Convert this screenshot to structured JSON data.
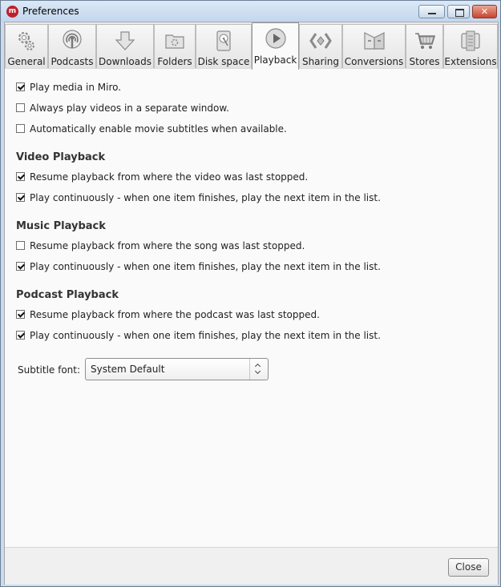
{
  "window": {
    "title": "Preferences",
    "app_icon": "m",
    "close_glyph": "✕"
  },
  "tabs": [
    {
      "label": "General",
      "icon": "gears-icon"
    },
    {
      "label": "Podcasts",
      "icon": "podcast-icon"
    },
    {
      "label": "Downloads",
      "icon": "download-arrow-icon"
    },
    {
      "label": "Folders",
      "icon": "folder-icon"
    },
    {
      "label": "Disk space",
      "icon": "hard-disk-icon"
    },
    {
      "label": "Playback",
      "icon": "play-icon",
      "selected": true
    },
    {
      "label": "Sharing",
      "icon": "sharing-icon"
    },
    {
      "label": "Conversions",
      "icon": "conversions-icon"
    },
    {
      "label": "Stores",
      "icon": "shopping-cart-icon"
    },
    {
      "label": "Extensions",
      "icon": "extensions-icon"
    }
  ],
  "general": [
    {
      "label": "Play media in Miro.",
      "checked": true
    },
    {
      "label": "Always play videos in a separate window.",
      "checked": false
    },
    {
      "label": "Automatically enable movie subtitles when available.",
      "checked": false
    }
  ],
  "video": {
    "heading": "Video Playback",
    "items": [
      {
        "label": "Resume playback from where the video was last stopped.",
        "checked": true
      },
      {
        "label": "Play continuously - when one item finishes, play the next item in the list.",
        "checked": true
      }
    ]
  },
  "music": {
    "heading": "Music Playback",
    "items": [
      {
        "label": "Resume playback from where the song was last stopped.",
        "checked": false
      },
      {
        "label": "Play continuously - when one item finishes, play the next item in the list.",
        "checked": true
      }
    ]
  },
  "podcast": {
    "heading": "Podcast Playback",
    "items": [
      {
        "label": "Resume playback from where the podcast was last stopped.",
        "checked": true
      },
      {
        "label": "Play continuously - when one item finishes, play the next item in the list.",
        "checked": true
      }
    ]
  },
  "subtitle_font": {
    "label": "Subtitle font:",
    "value": "System Default"
  },
  "footer": {
    "close_label": "Close"
  }
}
